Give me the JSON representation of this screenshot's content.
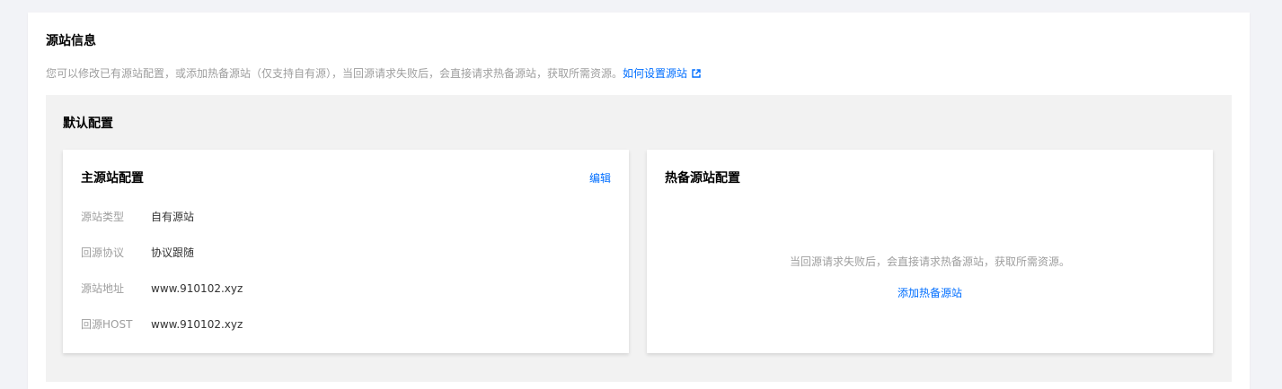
{
  "origin_panel": {
    "title": "源站信息",
    "description": "您可以修改已有源站配置，或添加热备源站（仅支持自有源），当回源请求失败后，会直接请求热备源站，获取所需资源。",
    "help_link": "如何设置源站",
    "help_link_icon": "external-link-icon",
    "link_color": "#006eff"
  },
  "default_config": {
    "title": "默认配置"
  },
  "main_origin": {
    "title": "主源站配置",
    "edit_label": "编辑",
    "rows": [
      {
        "label": "源站类型",
        "value": "自有源站"
      },
      {
        "label": "回源协议",
        "value": "协议跟随"
      },
      {
        "label": "源站地址",
        "value": "www.910102.xyz"
      },
      {
        "label": "回源HOST",
        "value": "www.910102.xyz"
      }
    ]
  },
  "backup_origin": {
    "title": "热备源站配置",
    "empty_text": "当回源请求失败后，会直接请求热备源站，获取所需资源。",
    "add_label": "添加热备源站"
  }
}
